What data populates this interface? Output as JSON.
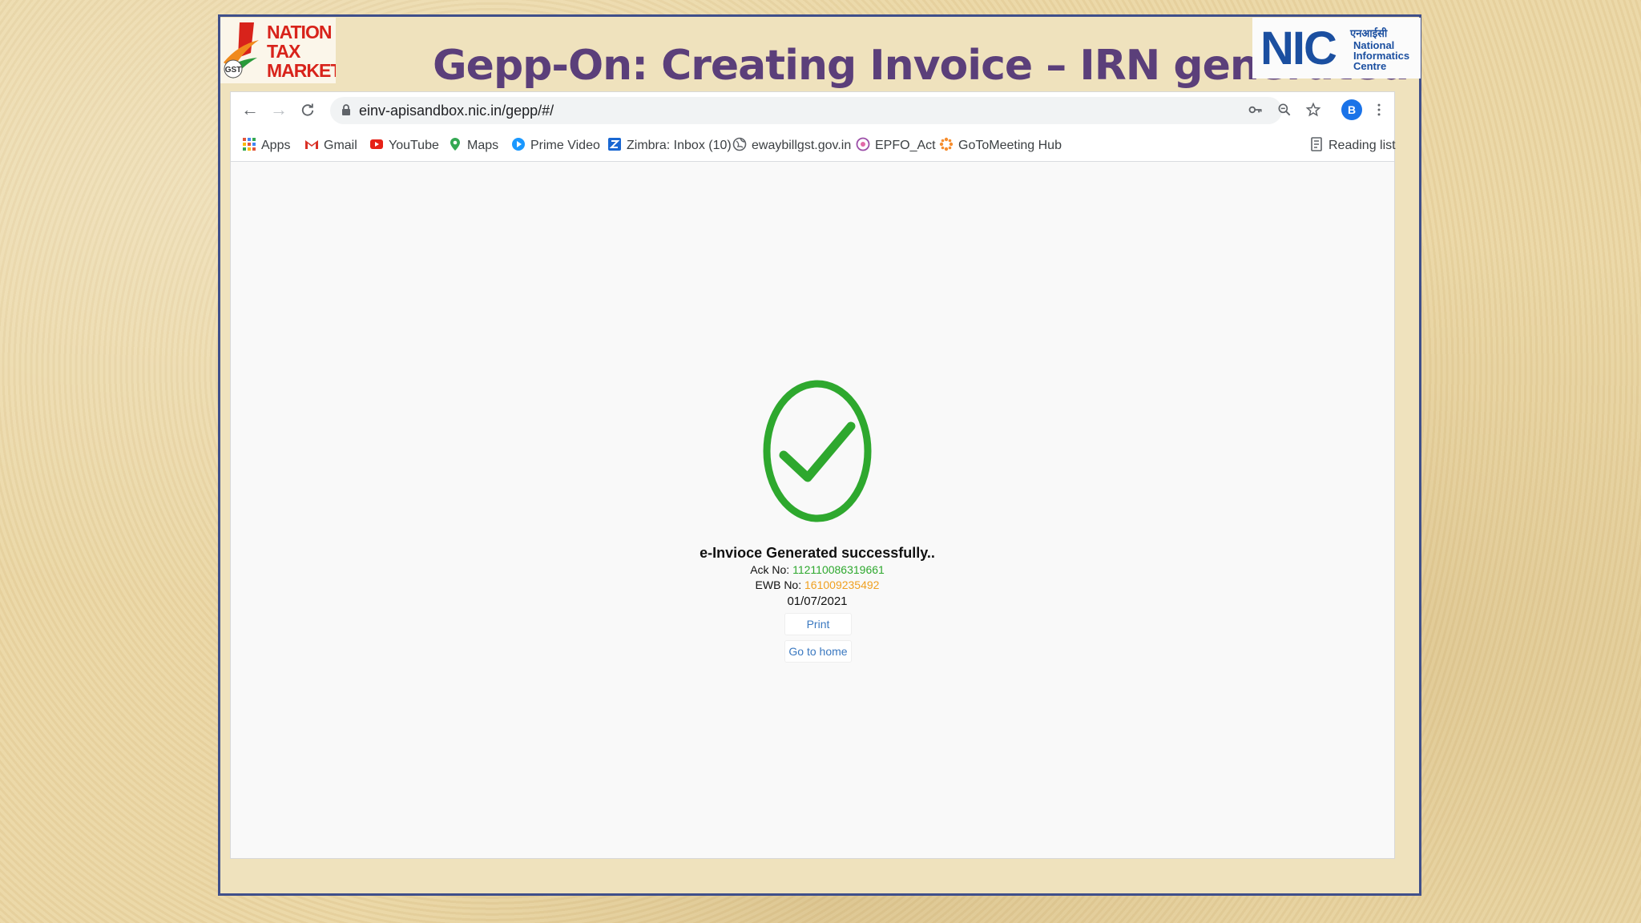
{
  "slide": {
    "title": "Gepp-On: Creating Invoice – IRN generated",
    "logo_left": [
      "NATION",
      "TAX",
      "MARKET"
    ],
    "logo_left_badge": "GST",
    "logo_right_main": "NIC",
    "logo_right_hindi": "एनआईसी",
    "logo_right_lines": [
      "National",
      "Informatics",
      "Centre"
    ]
  },
  "browser": {
    "url": "einv-apisandbox.nic.in/gepp/#/",
    "avatar_letter": "B",
    "bookmarks": [
      {
        "label": "Apps",
        "icon": "apps-grid-icon"
      },
      {
        "label": "Gmail",
        "icon": "gmail-icon"
      },
      {
        "label": "YouTube",
        "icon": "youtube-icon"
      },
      {
        "label": "Maps",
        "icon": "maps-icon"
      },
      {
        "label": "Prime Video",
        "icon": "prime-video-icon"
      },
      {
        "label": "Zimbra: Inbox (10)",
        "icon": "zimbra-icon"
      },
      {
        "label": "ewaybillgst.gov.in",
        "icon": "globe-icon"
      },
      {
        "label": "EPFO_Act",
        "icon": "epfo-icon"
      },
      {
        "label": "GoToMeeting Hub",
        "icon": "gotomeeting-icon"
      }
    ],
    "reading_list": "Reading list"
  },
  "result": {
    "message": "e-Invioce Generated successfully..",
    "ack_label": "Ack No:",
    "ack_value": "112110086319661",
    "ewb_label": "EWB No:",
    "ewb_value": "161009235492",
    "date": "01/07/2021",
    "print_label": "Print",
    "home_label": "Go to home"
  },
  "colors": {
    "success_green": "#2ea82e",
    "ewb_orange": "#f0a020",
    "link_blue": "#3a78c0",
    "title_purple": "#5b3f7a",
    "frame_blue": "#3f4f8a"
  }
}
